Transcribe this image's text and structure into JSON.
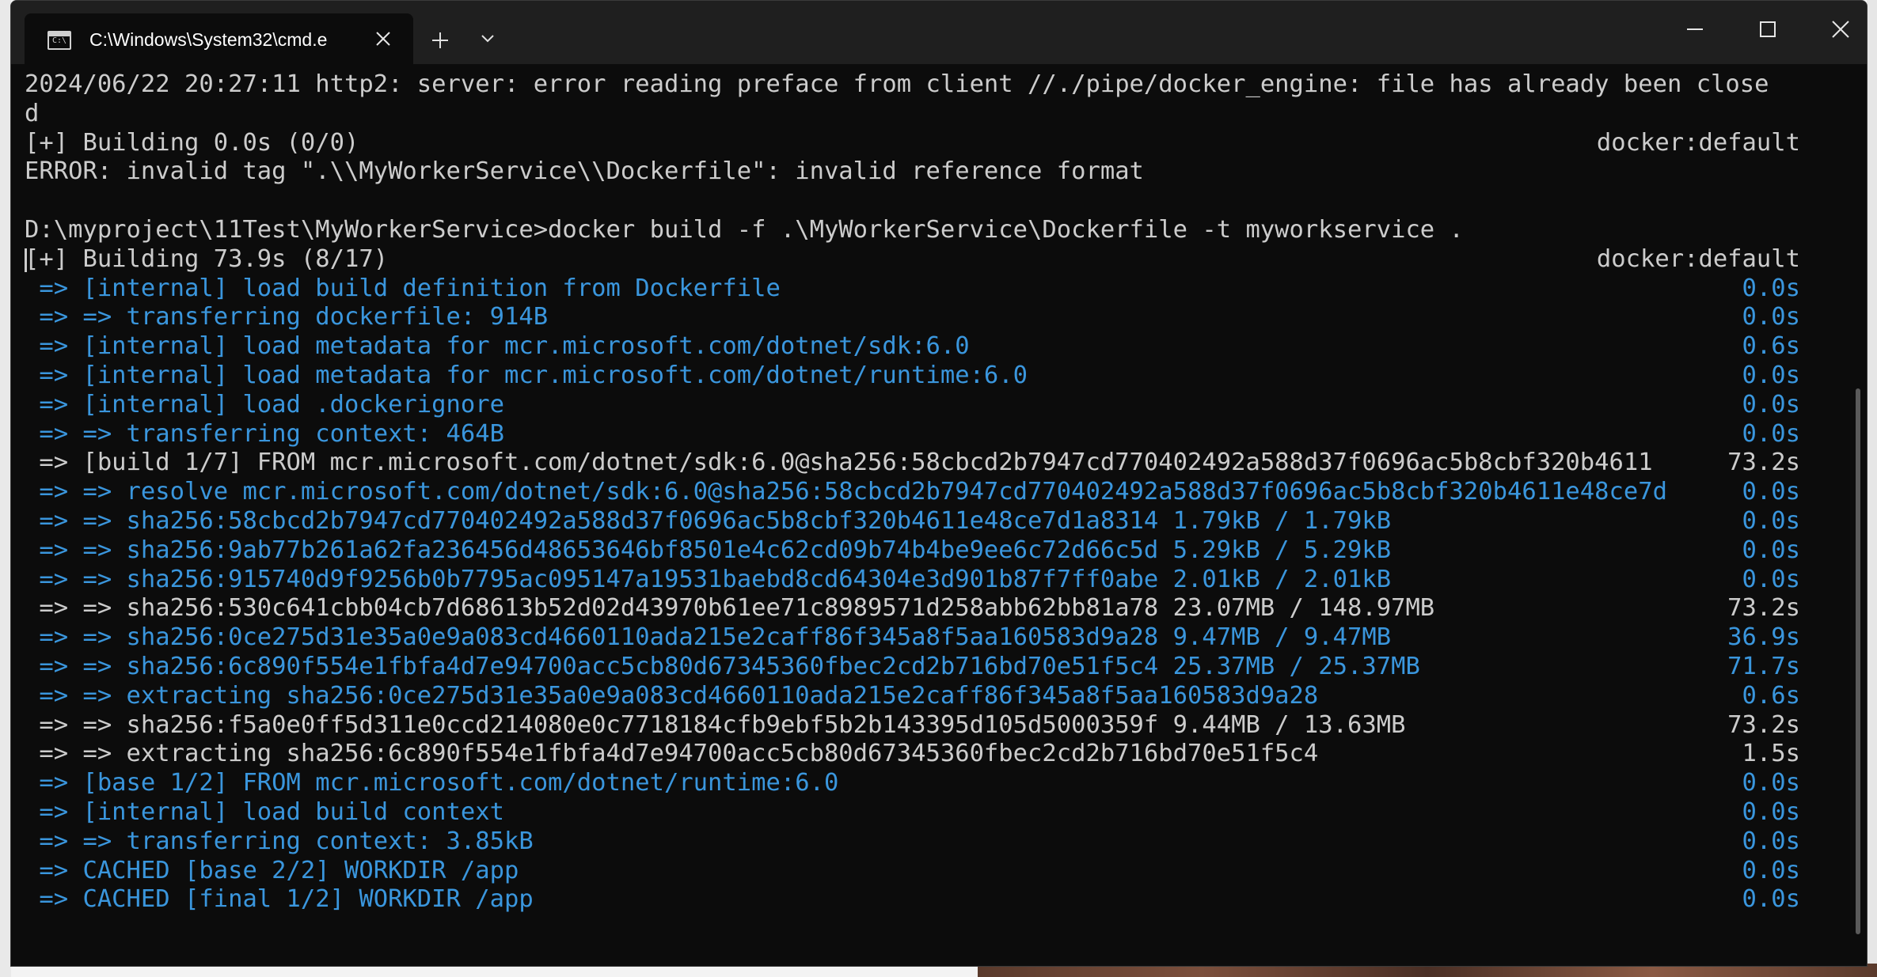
{
  "window": {
    "tab_title": "C:\\Windows\\System32\\cmd.e",
    "tab_icon_glyph": "C:\\"
  },
  "lines": [
    {
      "text": "2024/06/22 20:27:11 http2: server: error reading preface from client //./pipe/docker_engine: file has already been close",
      "right": "",
      "color": "white"
    },
    {
      "text": "d",
      "right": "",
      "color": "white"
    },
    {
      "text": "[+] Building 0.0s (0/0)",
      "right": "docker:default",
      "color": "white"
    },
    {
      "text": "ERROR: invalid tag \".\\\\MyWorkerService\\\\Dockerfile\": invalid reference format",
      "right": "",
      "color": "white"
    },
    {
      "text": "",
      "right": "",
      "color": "white"
    },
    {
      "text": "D:\\myproject\\11Test\\MyWorkerService>docker build -f .\\MyWorkerService\\Dockerfile -t myworkservice .",
      "right": "",
      "color": "white"
    },
    {
      "text": "[+] Building 73.9s (8/17)",
      "right": "docker:default",
      "color": "white"
    },
    {
      "text": " => [internal] load build definition from Dockerfile",
      "right": "0.0s",
      "color": "blue"
    },
    {
      "text": " => => transferring dockerfile: 914B",
      "right": "0.0s",
      "color": "blue"
    },
    {
      "text": " => [internal] load metadata for mcr.microsoft.com/dotnet/sdk:6.0",
      "right": "0.6s",
      "color": "blue"
    },
    {
      "text": " => [internal] load metadata for mcr.microsoft.com/dotnet/runtime:6.0",
      "right": "0.0s",
      "color": "blue"
    },
    {
      "text": " => [internal] load .dockerignore",
      "right": "0.0s",
      "color": "blue"
    },
    {
      "text": " => => transferring context: 464B",
      "right": "0.0s",
      "color": "blue"
    },
    {
      "text": " => [build 1/7] FROM mcr.microsoft.com/dotnet/sdk:6.0@sha256:58cbcd2b7947cd770402492a588d37f0696ac5b8cbf320b4611",
      "right": "73.2s",
      "color": "white"
    },
    {
      "text": " => => resolve mcr.microsoft.com/dotnet/sdk:6.0@sha256:58cbcd2b7947cd770402492a588d37f0696ac5b8cbf320b4611e48ce7d",
      "right": "0.0s",
      "color": "blue"
    },
    {
      "text": " => => sha256:58cbcd2b7947cd770402492a588d37f0696ac5b8cbf320b4611e48ce7d1a8314 1.79kB / 1.79kB",
      "right": "0.0s",
      "color": "blue"
    },
    {
      "text": " => => sha256:9ab77b261a62fa236456d48653646bf8501e4c62cd09b74b4be9ee6c72d66c5d 5.29kB / 5.29kB",
      "right": "0.0s",
      "color": "blue"
    },
    {
      "text": " => => sha256:915740d9f9256b0b7795ac095147a19531baebd8cd64304e3d901b87f7ff0abe 2.01kB / 2.01kB",
      "right": "0.0s",
      "color": "blue"
    },
    {
      "text": " => => sha256:530c641cbb04cb7d68613b52d02d43970b61ee71c8989571d258abb62bb81a78 23.07MB / 148.97MB",
      "right": "73.2s",
      "color": "white"
    },
    {
      "text": " => => sha256:0ce275d31e35a0e9a083cd4660110ada215e2caff86f345a8f5aa160583d9a28 9.47MB / 9.47MB",
      "right": "36.9s",
      "color": "blue"
    },
    {
      "text": " => => sha256:6c890f554e1fbfa4d7e94700acc5cb80d67345360fbec2cd2b716bd70e51f5c4 25.37MB / 25.37MB",
      "right": "71.7s",
      "color": "blue"
    },
    {
      "text": " => => extracting sha256:0ce275d31e35a0e9a083cd4660110ada215e2caff86f345a8f5aa160583d9a28",
      "right": "0.6s",
      "color": "blue"
    },
    {
      "text": " => => sha256:f5a0e0ff5d311e0ccd214080e0c7718184cfb9ebf5b2b143395d105d5000359f 9.44MB / 13.63MB",
      "right": "73.2s",
      "color": "white"
    },
    {
      "text": " => => extracting sha256:6c890f554e1fbfa4d7e94700acc5cb80d67345360fbec2cd2b716bd70e51f5c4",
      "right": "1.5s",
      "color": "white"
    },
    {
      "text": " => [base 1/2] FROM mcr.microsoft.com/dotnet/runtime:6.0",
      "right": "0.0s",
      "color": "blue"
    },
    {
      "text": " => [internal] load build context",
      "right": "0.0s",
      "color": "blue"
    },
    {
      "text": " => => transferring context: 3.85kB",
      "right": "0.0s",
      "color": "blue"
    },
    {
      "text": " => CACHED [base 2/2] WORKDIR /app",
      "right": "0.0s",
      "color": "blue"
    },
    {
      "text": " => CACHED [final 1/2] WORKDIR /app",
      "right": "0.0s",
      "color": "blue"
    }
  ],
  "colors": {
    "blue": "#3a96dd",
    "white": "#cccccc",
    "background": "#0c0c0c",
    "titlebar": "#1f1f1f"
  },
  "icons": {
    "tab": "terminal-icon",
    "close_tab": "close-icon",
    "new_tab": "plus-icon",
    "dropdown": "chevron-down-icon",
    "minimize": "minimize-icon",
    "maximize": "maximize-icon",
    "close_window": "close-icon"
  }
}
